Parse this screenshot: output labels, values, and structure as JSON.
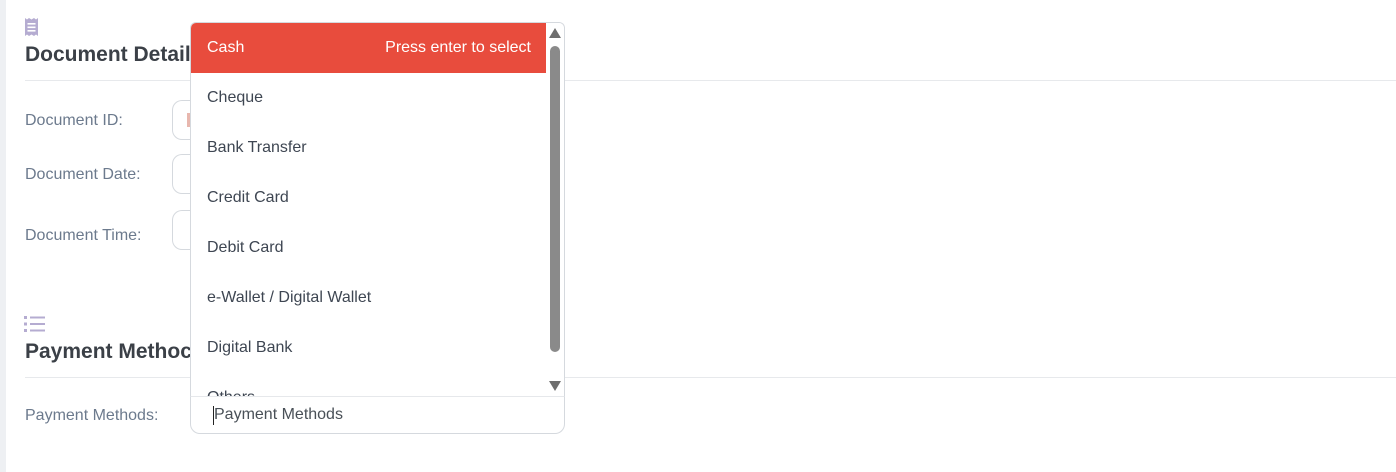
{
  "sections": {
    "document_details": {
      "title": "Document Detail",
      "icon": "receipt-icon"
    },
    "payment": {
      "title": "Payment Methoc",
      "icon": "list-icon"
    }
  },
  "form": {
    "document_id_label": "Document ID:",
    "document_date_label": "Document Date:",
    "document_time_label": "Document Time:",
    "payment_methods_label": "Payment Methods:"
  },
  "payment_select": {
    "placeholder": "Payment Methods",
    "highlight_color": "#e84c3d",
    "enter_hint": "Press enter to select",
    "options": [
      "Cash",
      "Cheque",
      "Bank Transfer",
      "Credit Card",
      "Debit Card",
      "e-Wallet / Digital Wallet",
      "Digital Bank",
      "Others"
    ]
  }
}
